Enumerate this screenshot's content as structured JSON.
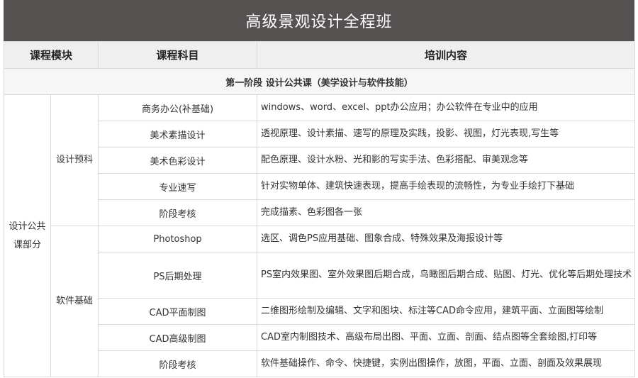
{
  "title": "高级景观设计全程班",
  "headers": {
    "module": "课程模块",
    "subject": "课程科目",
    "content": "培训内容"
  },
  "stage": "第一阶段 设计公共课（美学设计与软件技能）",
  "group": "设计公共课部分",
  "submodules": {
    "design_prep": "设计预科",
    "software": "软件基础"
  },
  "rows": [
    {
      "subject": "商务办公(补基础)",
      "content": "windows、word、excel、ppt办公应用；办公软件在专业中的应用"
    },
    {
      "subject": "美术素描设计",
      "content": "透视原理、设计素描、速写的原理及实践，投影、视图，灯光表现,写生等"
    },
    {
      "subject": "美术色彩设计",
      "content": "配色原理、设计水粉、光和影的写实手法、色彩搭配、审美观念等"
    },
    {
      "subject": "专业速写",
      "content": "针对实物单体、建筑快速表现，提高手绘表现的流畅性，为专业手绘打下基础"
    },
    {
      "subject": "阶段考核",
      "content": "完成描素、色彩图各一张"
    },
    {
      "subject": "Photoshop",
      "content": "选区、调色PS应用基础、图象合成、特殊效果及海报设计等"
    },
    {
      "subject": "PS后期处理",
      "content": "PS室内效果图、室外效果图后期合成，鸟瞰图后期合成、贴图、灯光、优化等后期处理技术"
    },
    {
      "subject": "CAD平面制图",
      "content": "二维图形绘制及编辑、文字和图块、标注等CAD命令应用，建筑平面、立面图等绘制"
    },
    {
      "subject": "CAD高级制图",
      "content": "CAD室内制图技术、高级布局出图、平面、立面、剖面、结点图等全套绘图,打印等"
    },
    {
      "subject": "阶段考核",
      "content": "软件基础操作、命令、快捷键，实例出图操作，放图，平面、立面、剖面及效果展现"
    }
  ]
}
